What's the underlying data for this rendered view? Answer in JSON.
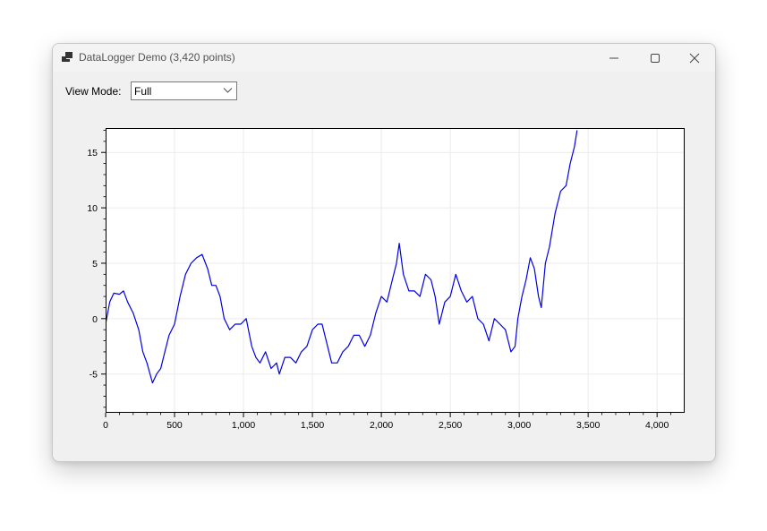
{
  "window": {
    "title": "DataLogger Demo (3,420 points)"
  },
  "toolbar": {
    "view_mode_label": "View Mode:",
    "view_mode_value": "Full"
  },
  "colors": {
    "series": "#0000e6",
    "grid": "#ebebeb",
    "window_bg": "#f0f0f0"
  },
  "icons": {
    "app": "app-icon",
    "minimize": "minimize-icon",
    "maximize": "maximize-icon",
    "close": "close-icon",
    "dropdown": "chevron-down-icon"
  },
  "chart_data": {
    "type": "line",
    "title": "",
    "xlabel": "",
    "ylabel": "",
    "xlim": [
      0,
      4200
    ],
    "ylim": [
      -8.5,
      17.2
    ],
    "xticks": [
      0,
      500,
      1000,
      1500,
      2000,
      2500,
      3000,
      3500,
      4000
    ],
    "xtick_labels": [
      "0",
      "500",
      "1,000",
      "1,500",
      "2,000",
      "2,500",
      "3,000",
      "3,500",
      "4,000"
    ],
    "yticks": [
      -5,
      0,
      5,
      10,
      15
    ],
    "ytick_labels": [
      "-5",
      "0",
      "5",
      "10",
      "15"
    ],
    "grid": true,
    "legend": "none",
    "series": [
      {
        "x": [
          0,
          30,
          60,
          100,
          130,
          160,
          200,
          240,
          270,
          300,
          340,
          370,
          400,
          430,
          460,
          500,
          540,
          580,
          620,
          660,
          700,
          740,
          770,
          800,
          830,
          860,
          900,
          940,
          980,
          1020,
          1060,
          1090,
          1120,
          1160,
          1200,
          1240,
          1260,
          1300,
          1340,
          1380,
          1420,
          1460,
          1500,
          1540,
          1570,
          1600,
          1640,
          1680,
          1720,
          1760,
          1800,
          1840,
          1880,
          1920,
          1960,
          2000,
          2040,
          2080,
          2110,
          2130,
          2160,
          2200,
          2240,
          2280,
          2320,
          2360,
          2390,
          2420,
          2460,
          2500,
          2540,
          2580,
          2620,
          2660,
          2700,
          2740,
          2780,
          2820,
          2860,
          2900,
          2940,
          2970,
          2990,
          3020,
          3050,
          3080,
          3110,
          3140,
          3160,
          3190,
          3220,
          3260,
          3300,
          3340,
          3370,
          3400,
          3420
        ],
        "values": [
          -0.5,
          1.5,
          2.3,
          2.2,
          2.5,
          1.5,
          0.5,
          -1.0,
          -3.0,
          -4.0,
          -5.8,
          -5.0,
          -4.5,
          -3.0,
          -1.5,
          -0.5,
          2.0,
          4.0,
          5.0,
          5.5,
          5.8,
          4.5,
          3.0,
          3.0,
          2.0,
          0.0,
          -1.0,
          -0.5,
          -0.5,
          0.0,
          -2.5,
          -3.5,
          -4.0,
          -3.0,
          -4.5,
          -4.0,
          -5.0,
          -3.5,
          -3.5,
          -4.0,
          -3.0,
          -2.5,
          -1.0,
          -0.5,
          -0.5,
          -2.0,
          -4.0,
          -4.0,
          -3.0,
          -2.5,
          -1.5,
          -1.5,
          -2.5,
          -1.5,
          0.5,
          2.0,
          1.5,
          3.5,
          5.0,
          6.8,
          4.0,
          2.5,
          2.5,
          2.0,
          4.0,
          3.5,
          2.0,
          -0.5,
          1.5,
          2.0,
          4.0,
          2.5,
          1.5,
          2.0,
          0.0,
          -0.5,
          -2.0,
          0.0,
          -0.5,
          -1.0,
          -3.0,
          -2.5,
          0.0,
          2.0,
          3.5,
          5.5,
          4.5,
          2.0,
          1.0,
          5.0,
          6.5,
          9.5,
          11.5,
          12.0,
          14.0,
          15.5,
          17.0
        ]
      }
    ]
  }
}
